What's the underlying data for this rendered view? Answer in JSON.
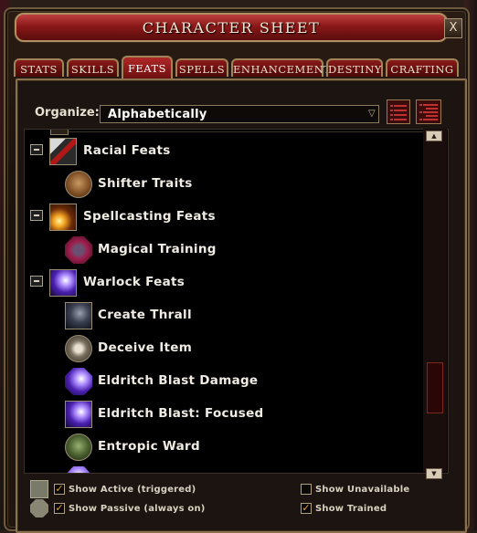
{
  "window": {
    "title": "CHARACTER SHEET",
    "close_label": "X"
  },
  "tabs": [
    {
      "label": "STATS",
      "active": false
    },
    {
      "label": "SKILLS",
      "active": false
    },
    {
      "label": "FEATS",
      "active": true
    },
    {
      "label": "SPELLS",
      "active": false
    },
    {
      "label": "ENHANCEMENT",
      "active": false
    },
    {
      "label": "DESTINY",
      "active": false
    },
    {
      "label": "CRAFTING",
      "active": false
    }
  ],
  "organize": {
    "label": "Organize:",
    "value": "Alphabetically"
  },
  "feats": [
    {
      "label": "Racial Feats",
      "type": "category",
      "icon": "racial-feats-icon"
    },
    {
      "label": "Shifter Traits",
      "type": "feat",
      "icon": "shifter-traits-icon"
    },
    {
      "label": "Spellcasting Feats",
      "type": "category",
      "icon": "spellcasting-feats-icon"
    },
    {
      "label": "Magical Training",
      "type": "feat",
      "icon": "magical-training-icon"
    },
    {
      "label": "Warlock Feats",
      "type": "category",
      "icon": "warlock-feats-icon"
    },
    {
      "label": "Create Thrall",
      "type": "feat",
      "icon": "create-thrall-icon"
    },
    {
      "label": "Deceive Item",
      "type": "feat",
      "icon": "deceive-item-icon"
    },
    {
      "label": "Eldritch Blast Damage",
      "type": "feat",
      "icon": "eldritch-blast-damage-icon"
    },
    {
      "label": "Eldritch Blast: Focused",
      "type": "feat",
      "icon": "eldritch-blast-focused-icon"
    },
    {
      "label": "Entropic Ward",
      "type": "feat",
      "icon": "entropic-ward-icon"
    }
  ],
  "filters": {
    "show_active": {
      "label": "Show Active (triggered)",
      "checked": true
    },
    "show_passive": {
      "label": "Show Passive (always on)",
      "checked": true
    },
    "show_unavailable": {
      "label": "Show Unavailable",
      "checked": false
    },
    "show_trained": {
      "label": "Show Trained",
      "checked": true
    }
  },
  "checkmark": "✓",
  "colors": {
    "title_red": "#8a1818",
    "border_gold": "#a08458",
    "panel_bg": "#1c1410",
    "check_orange": "#e8a030"
  }
}
